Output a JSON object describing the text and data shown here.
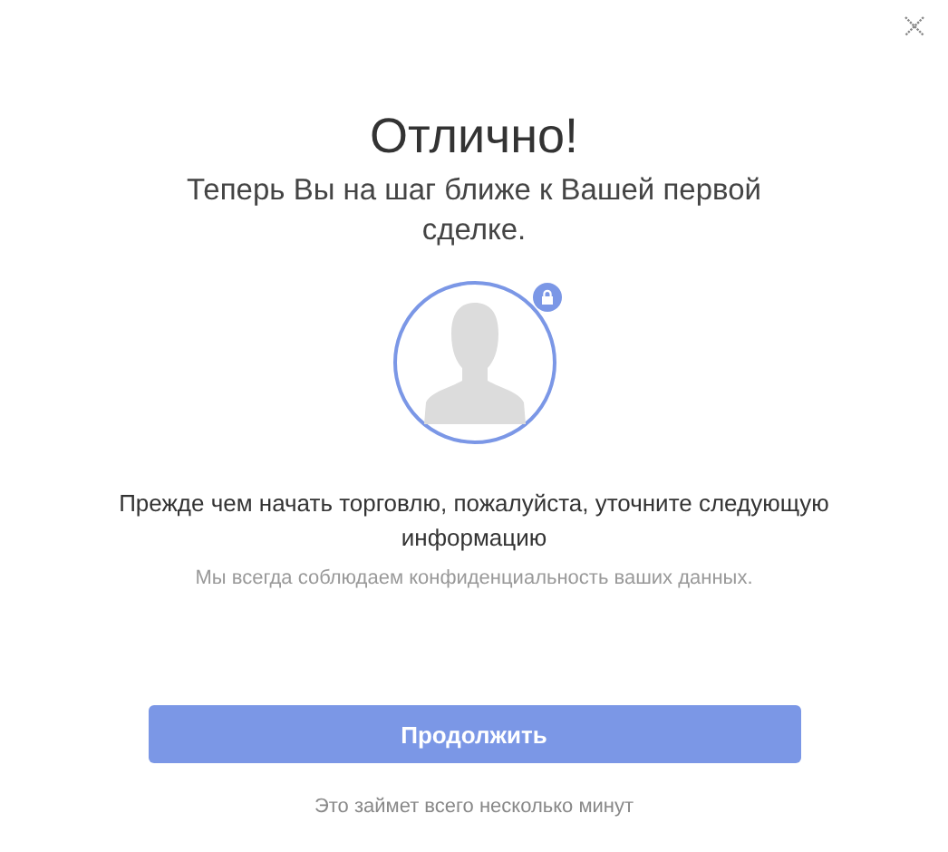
{
  "title": "Отлично!",
  "subtitle": "Теперь Вы на шаг ближе к Вашей первой сделке.",
  "instruction": "Прежде чем начать торговлю, пожалуйста, уточните следующую информацию",
  "privacy_note": "Мы всегда соблюдаем конфиденциальность ваших данных.",
  "button": "Продолжить",
  "footer": "Это займет всего несколько минут"
}
